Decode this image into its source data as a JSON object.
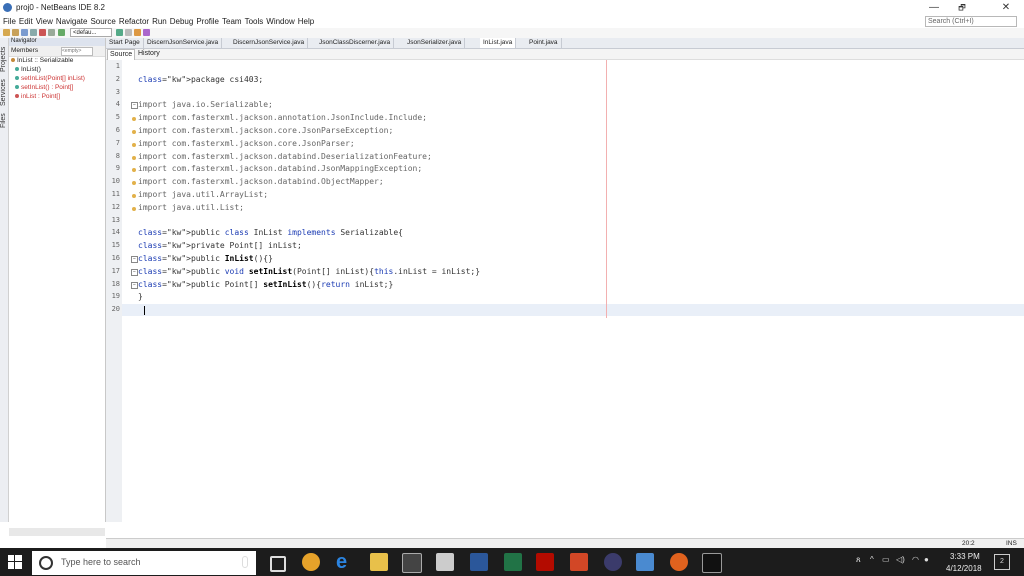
{
  "window": {
    "title": "proj0 - NetBeans IDE 8.2",
    "min": "—",
    "max": "🗗",
    "close": "✕"
  },
  "menu": [
    "File",
    "Edit",
    "View",
    "Navigate",
    "Source",
    "Refactor",
    "Run",
    "Debug",
    "Profile",
    "Team",
    "Tools",
    "Window",
    "Help"
  ],
  "search_placeholder": "Search (Ctrl+I)",
  "toolbar": {
    "config": "<defau..."
  },
  "side_tabs": [
    "Projects",
    "Services",
    "Files"
  ],
  "navigator": {
    "header": "Navigator",
    "members_label": "Members",
    "empty_select": "<empty>",
    "class_node": "InList :: Serializable",
    "items": [
      "InList()",
      "setInList(Point[] inList)",
      "setInList() : Point[]",
      "inList : Point[]"
    ]
  },
  "editor_tabs": [
    "Start Page",
    "DiscernJsonService.java",
    "DiscernJsonService.java",
    "JsonClassDiscerner.java",
    "JsonSerializer.java",
    "InList.java",
    "Point.java"
  ],
  "editor_subtabs": {
    "source": "Source",
    "history": "History"
  },
  "code_lines": [
    {
      "n": "1",
      "text": ""
    },
    {
      "n": "2",
      "text": "package csi403;"
    },
    {
      "n": "3",
      "text": ""
    },
    {
      "n": "4",
      "text": "import java.io.Serializable;"
    },
    {
      "n": "5",
      "text": "import com.fasterxml.jackson.annotation.JsonInclude.Include;"
    },
    {
      "n": "6",
      "text": "import com.fasterxml.jackson.core.JsonParseException;"
    },
    {
      "n": "7",
      "text": "import com.fasterxml.jackson.core.JsonParser;"
    },
    {
      "n": "8",
      "text": "import com.fasterxml.jackson.databind.DeserializationFeature;"
    },
    {
      "n": "9",
      "text": "import com.fasterxml.jackson.databind.JsonMappingException;"
    },
    {
      "n": "10",
      "text": "import com.fasterxml.jackson.databind.ObjectMapper;"
    },
    {
      "n": "11",
      "text": "import java.util.ArrayList;"
    },
    {
      "n": "12",
      "text": "import java.util.List;"
    },
    {
      "n": "13",
      "text": ""
    },
    {
      "n": "14",
      "text": "public class InList implements Serializable{"
    },
    {
      "n": "15",
      "text": "private Point[] inList;"
    },
    {
      "n": "16",
      "text": "public InList(){}"
    },
    {
      "n": "17",
      "text": "public void setInList(Point[] inList){this.inList = inList;}"
    },
    {
      "n": "18",
      "text": "public Point[] setInList(){return inList;}"
    },
    {
      "n": "19",
      "text": "}"
    },
    {
      "n": "20",
      "text": ""
    }
  ],
  "status": {
    "position": "20:2",
    "mode": "INS"
  },
  "taskbar": {
    "search_text": "Type here to search",
    "time": "3:33 PM",
    "date": "4/12/2018",
    "notifications": "2"
  }
}
